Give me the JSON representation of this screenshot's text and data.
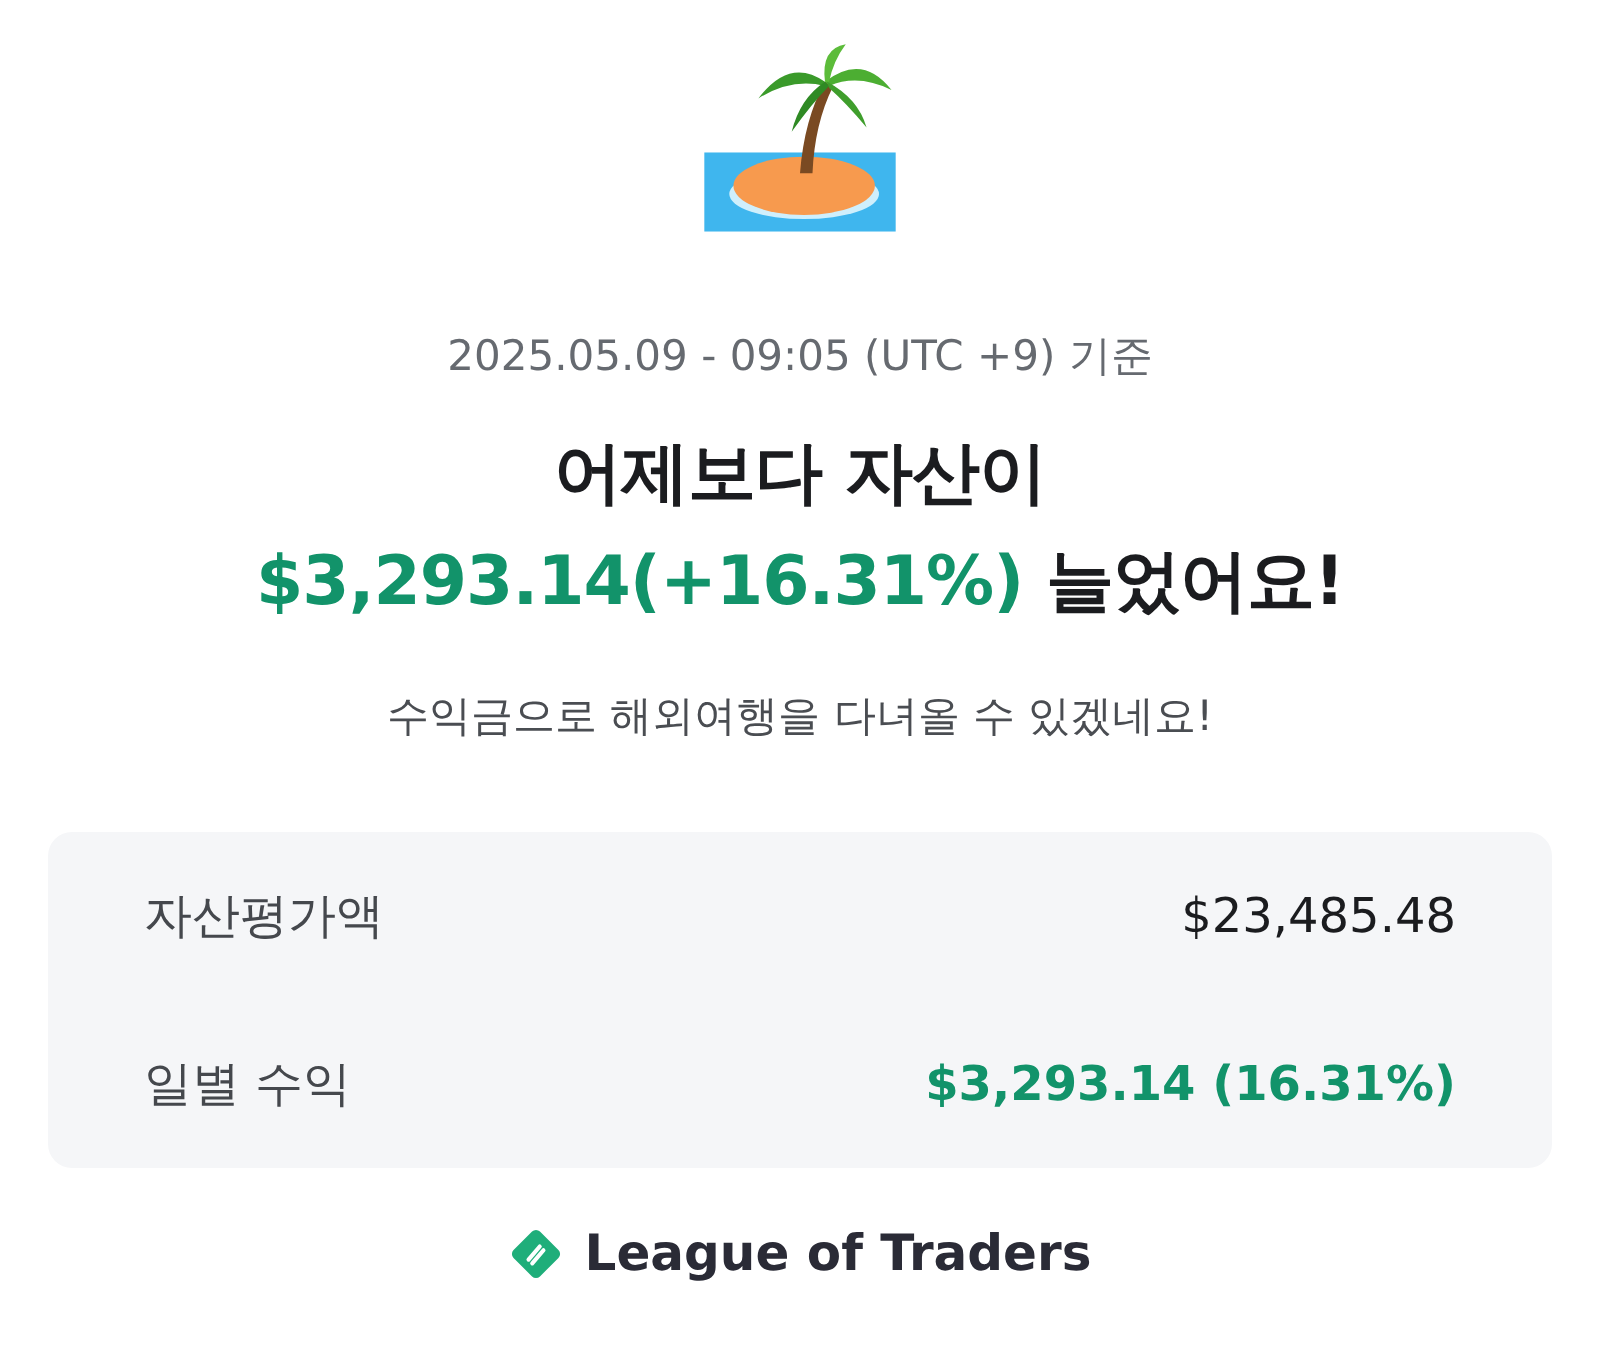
{
  "timestamp": "2025.05.09 - 09:05 (UTC +9) 기준",
  "headline": {
    "line_1": "어제보다 자산이",
    "amount": "$3,293.14(+16.31%)",
    "suffix": "늘었어요!"
  },
  "subtitle": "수익금으로 해외여행을 다녀올 수 있겠네요!",
  "summary": [
    {
      "label": "자산평가액",
      "value": "$23,485.48",
      "kind": "plain"
    },
    {
      "label": "일별 수익",
      "value": "$3,293.14 (16.31%)",
      "kind": "gain"
    }
  ],
  "brand": "League of Traders"
}
